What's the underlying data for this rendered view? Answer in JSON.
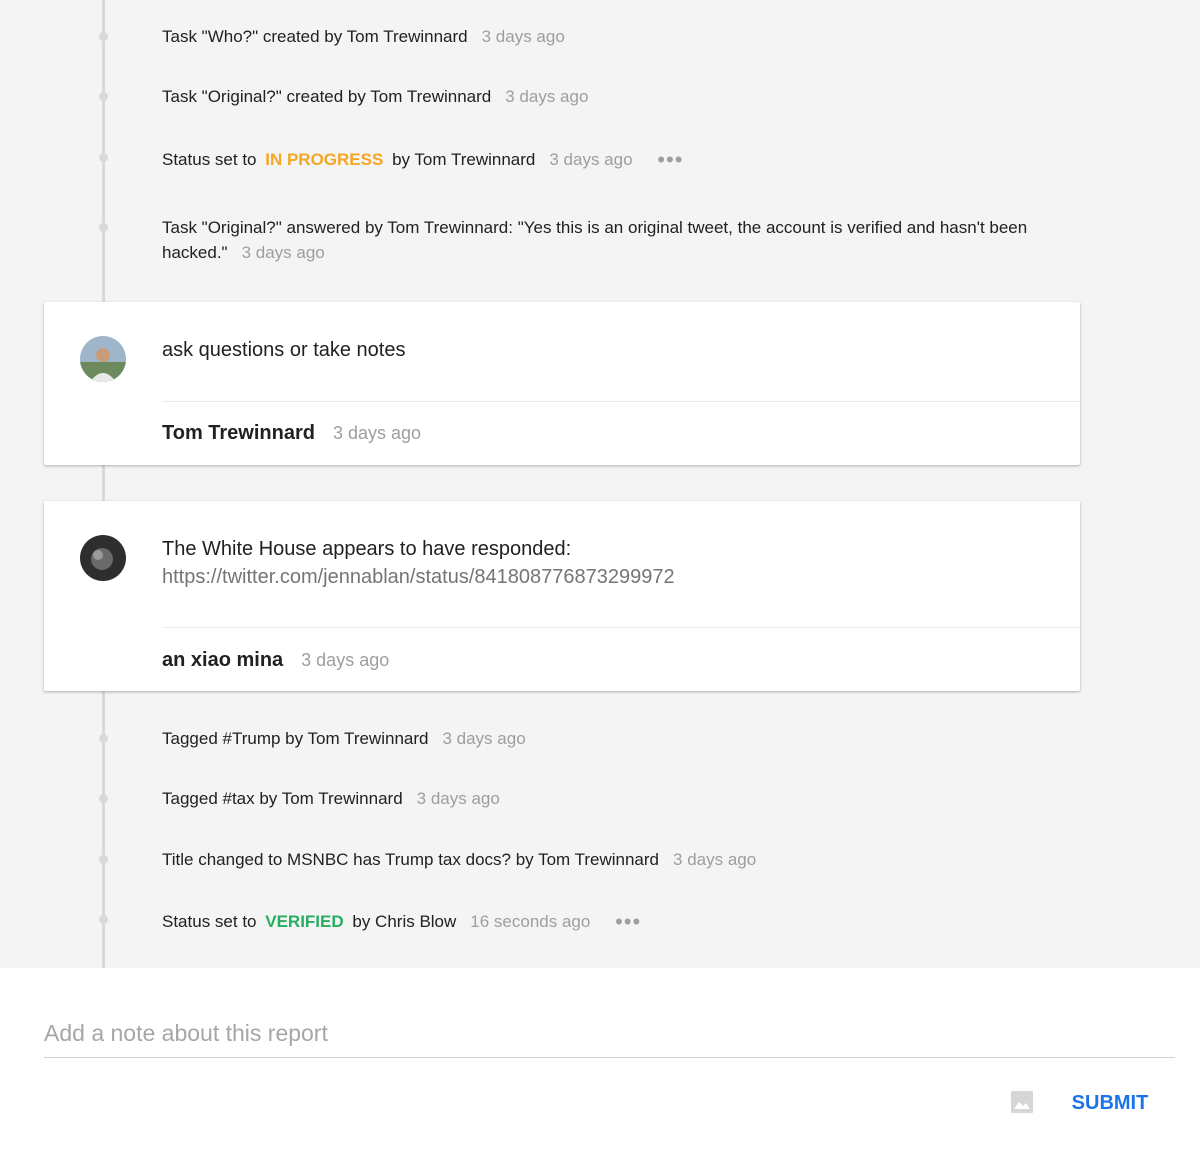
{
  "events_top": [
    {
      "parts": [
        "Task \"Who?\" created by Tom Trewinnard"
      ],
      "time": "3 days ago"
    },
    {
      "parts": [
        "Task \"Original?\" created by Tom Trewinnard"
      ],
      "time": "3 days ago"
    },
    {
      "prefix": "Status set to",
      "status": "IN PROGRESS",
      "suffix": "by Tom Trewinnard",
      "time": "3 days ago"
    },
    {
      "text": "Task \"Original?\" answered by Tom Trewinnard: \"Yes this is an original tweet, the account is verified and hasn't been hacked.\"",
      "time": "3 days ago"
    }
  ],
  "comments": [
    {
      "text": "ask questions or take notes",
      "link": "",
      "author": "Tom Trewinnard",
      "time": "3 days ago",
      "avatar_color": "#6d8a5e"
    },
    {
      "text": "The White House appears to have responded:",
      "link": "https://twitter.com/jennablan/status/841808776873299972",
      "author": "an xiao mina",
      "time": "3 days ago",
      "avatar_color": "#3a3a3a"
    }
  ],
  "events_bottom": [
    {
      "text": "Tagged #Trump by Tom Trewinnard",
      "time": "3 days ago"
    },
    {
      "text": "Tagged #tax by Tom Trewinnard",
      "time": "3 days ago"
    },
    {
      "text": "Title changed to MSNBC has Trump tax docs? by Tom Trewinnard",
      "time": "3 days ago"
    },
    {
      "prefix": "Status set to",
      "status": "VERIFIED",
      "suffix": "by Chris Blow",
      "time": "16 seconds ago"
    }
  ],
  "more_icon": "•••",
  "composer": {
    "placeholder": "Add a note about this report",
    "submit_label": "SUBMIT",
    "image_icon": "image-icon"
  },
  "colors": {
    "in_progress": "#f5a623",
    "verified": "#27ae60",
    "accent": "#1a73e8"
  }
}
